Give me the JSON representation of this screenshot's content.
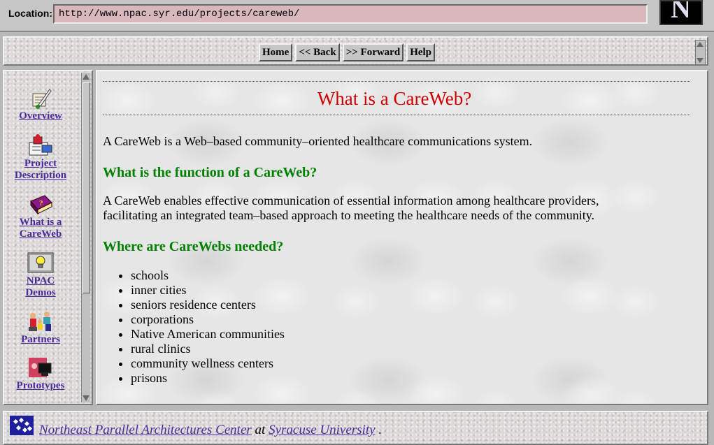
{
  "location": {
    "label": "Location:",
    "url": "http://www.npac.syr.edu/projects/careweb/"
  },
  "logo_letter": "N",
  "nav": {
    "buttons": [
      {
        "label": "Home"
      },
      {
        "label": "<< Back"
      },
      {
        "label": ">> Forward"
      },
      {
        "label": "Help"
      }
    ]
  },
  "sidebar": {
    "items": [
      {
        "label_1": "Overview",
        "label_2": "",
        "icon": "scroll-quill-icon"
      },
      {
        "label_1": "Project",
        "label_2": "Description",
        "icon": "package-icon"
      },
      {
        "label_1": "What is a",
        "label_2": "CareWeb",
        "icon": "question-book-icon"
      },
      {
        "label_1": "NPAC",
        "label_2": "Demos",
        "icon": "lightbulb-icon"
      },
      {
        "label_1": "Partners",
        "label_2": "",
        "icon": "people-icon"
      },
      {
        "label_1": "Prototypes",
        "label_2": "",
        "icon": "computer-icon"
      }
    ]
  },
  "main": {
    "title": "What is a CareWeb?",
    "intro": "A CareWeb is a Web–based community–oriented healthcare communications system.",
    "heading_1": "What is the function of a CareWeb?",
    "para_1_line_1": "A CareWeb enables effective communication of essential information among healthcare providers,",
    "para_1_line_2": "facilitating an integrated team–based approach to meeting the healthcare needs of the community.",
    "heading_2": "Where are CareWebs needed?",
    "places": [
      "schools",
      "inner cities",
      "seniors residence centers",
      "corporations",
      "Native American communities",
      "rural clinics",
      "community wellness centers",
      "prisons"
    ]
  },
  "footer": {
    "org": "Northeast Parallel Architectures Center",
    "at": " at ",
    "univ": "Syracuse University",
    "end": " ."
  }
}
